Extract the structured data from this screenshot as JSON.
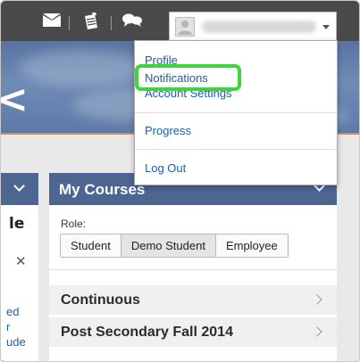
{
  "header": {
    "icons": [
      "mail-icon",
      "notepad-icon",
      "chat-icon"
    ],
    "user_caret": "chevron-down-icon"
  },
  "user_menu": {
    "items": [
      {
        "label": "Profile"
      },
      {
        "label": "Notifications"
      },
      {
        "label": "Account Settings"
      },
      {
        "label": "Progress"
      },
      {
        "label": "Log Out"
      }
    ],
    "highlight_color": "#3fd43a"
  },
  "left_widget": {
    "title_fragment": "le",
    "close_glyph": "✕",
    "link_fragments": [
      "ed",
      "r",
      "ude"
    ]
  },
  "my_courses": {
    "title": "My Courses",
    "role_label": "Role:",
    "roles": [
      "Student",
      "Demo Student",
      "Employee"
    ],
    "selected_role": "Demo Student",
    "courses": [
      "Continuous",
      "Post Secondary Fall 2014"
    ]
  },
  "colors": {
    "navbar": "#4a4a4a",
    "widget_header": "#4c6591",
    "link": "#1d5fa7",
    "banner_accent": "#c9925a"
  }
}
